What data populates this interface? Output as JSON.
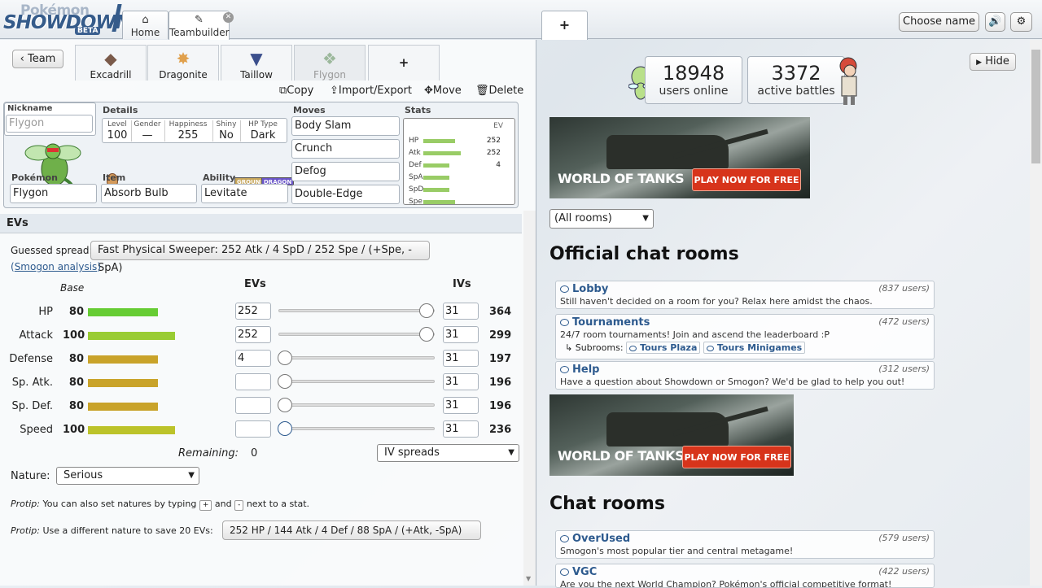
{
  "header": {
    "logo_top": "Pokémon",
    "logo_main": "SHOWDOWN",
    "logo_badge": "BETA",
    "tabs": [
      {
        "icon": "home-icon",
        "label": "Home"
      },
      {
        "icon": "edit-icon",
        "label": "Teambuilder"
      }
    ],
    "new_tab": "+",
    "choose_name": "Choose name",
    "sound_icon": "speaker-icon",
    "settings_icon": "gear-icon"
  },
  "teambuilder": {
    "back_label": "Team",
    "party": [
      "Excadrill",
      "Dragonite",
      "Taillow",
      "Flygon"
    ],
    "add_slot": "+",
    "actions": {
      "copy": "Copy",
      "import_export": "Import/Export",
      "move": "Move",
      "delete": "Delete"
    },
    "nickname_label": "Nickname",
    "nickname_placeholder": "Flygon",
    "details_label": "Details",
    "details": [
      {
        "label": "Level",
        "value": "100"
      },
      {
        "label": "Gender",
        "value": "—"
      },
      {
        "label": "Happiness",
        "value": "255"
      },
      {
        "label": "Shiny",
        "value": "No"
      },
      {
        "label": "HP Type",
        "value": "Dark"
      }
    ],
    "types": [
      "GROUND",
      "DRAGON"
    ],
    "type_colors": {
      "GROUND": "#c7a65a",
      "DRAGON": "#6a55c9"
    },
    "pokemon_label": "Pokémon",
    "pokemon": "Flygon",
    "item_label": "Item",
    "item": "Absorb Bulb",
    "ability_label": "Ability",
    "ability": "Levitate",
    "moves_label": "Moves",
    "moves": [
      "Body Slam",
      "Crunch",
      "Defog",
      "Double-Edge"
    ],
    "stats_label": "Stats",
    "stats_ev_header": "EV",
    "stat_rows": [
      {
        "abbr": "HP",
        "ev": "252",
        "fill": 0.55
      },
      {
        "abbr": "Atk",
        "ev": "252",
        "fill": 0.65
      },
      {
        "abbr": "Def",
        "ev": "4",
        "fill": 0.45
      },
      {
        "abbr": "SpA",
        "ev": "",
        "fill": 0.45
      },
      {
        "abbr": "SpD",
        "ev": "",
        "fill": 0.45
      },
      {
        "abbr": "Spe",
        "ev": "",
        "fill": 0.55
      }
    ]
  },
  "evs": {
    "section_title": "EVs",
    "guessed_label": "Guessed spread:",
    "guessed_spread": "Fast Physical Sweeper: 252 Atk / 4 SpD / 252 Spe / (+Spe, -SpA)",
    "smogon_open": "(",
    "smogon_link": "Smogon analysis",
    "smogon_close": ")",
    "col_base": "Base",
    "col_evs": "EVs",
    "col_ivs": "IVs",
    "rows": [
      {
        "stat": "HP",
        "base": "80",
        "ev": "252",
        "iv": "31",
        "total": "364",
        "bar_color": "#6c3",
        "ev_fill": 1.0
      },
      {
        "stat": "Attack",
        "base": "100",
        "ev": "252",
        "iv": "31",
        "total": "299",
        "bar_color": "#9c3",
        "ev_fill": 1.0
      },
      {
        "stat": "Defense",
        "base": "80",
        "ev": "4",
        "iv": "31",
        "total": "197",
        "bar_color": "#c9a32a",
        "ev_fill": 0.0
      },
      {
        "stat": "Sp. Atk.",
        "base": "80",
        "ev": "",
        "iv": "31",
        "total": "196",
        "bar_color": "#c9a32a",
        "ev_fill": 0.0
      },
      {
        "stat": "Sp. Def.",
        "base": "80",
        "ev": "",
        "iv": "31",
        "total": "196",
        "bar_color": "#c9a32a",
        "ev_fill": 0.0
      },
      {
        "stat": "Speed",
        "base": "100",
        "ev": "",
        "iv": "31",
        "total": "236",
        "bar_color": "#bcc32a",
        "ev_fill": 0.0
      }
    ],
    "remaining_label": "Remaining:",
    "remaining": "0",
    "iv_spreads": "IV spreads",
    "nature_label": "Nature:",
    "nature": "Serious",
    "protip1_label": "Protip:",
    "protip1_a": "You can also set natures by typing",
    "protip1_key1": "+",
    "protip1_and": "and",
    "protip1_key2": "-",
    "protip1_b": "next to a stat.",
    "protip2_label": "Protip:",
    "protip2_text": "Use a different nature to save 20 EVs:",
    "protip2_button": "252 HP / 144 Atk / 4 Def / 88 SpA / (+Atk, -SpA)"
  },
  "lobby": {
    "hide_label": "Hide",
    "users_online_count": "18948",
    "users_online_label": "users online",
    "battles_count": "3372",
    "battles_label": "active battles",
    "ad_brand": "WORLD OF TANKS",
    "ad_cta": "PLAY NOW FOR FREE",
    "room_filter": "(All rooms)",
    "official_title": "Official chat rooms",
    "official_rooms": [
      {
        "name": "Lobby",
        "users": "(837 users)",
        "desc": "Still haven't decided on a room for you? Relax here amidst the chaos."
      },
      {
        "name": "Tournaments",
        "users": "(472 users)",
        "desc": "24/7 room tournaments! Join and ascend the leaderboard :P"
      },
      {
        "name": "Help",
        "users": "(312 users)",
        "desc": "Have a question about Showdown or Smogon? We'd be glad to help you out!"
      }
    ],
    "subrooms_label": "Subrooms:",
    "subrooms": [
      "Tours Plaza",
      "Tours Minigames"
    ],
    "chat_title": "Chat rooms",
    "chat_rooms": [
      {
        "name": "OverUsed",
        "users": "(579 users)",
        "desc": "Smogon's most popular tier and central metagame!"
      },
      {
        "name": "VGC",
        "users": "(422 users)",
        "desc": "Are you the next World Champion? Pokémon's official competitive format!"
      }
    ]
  }
}
